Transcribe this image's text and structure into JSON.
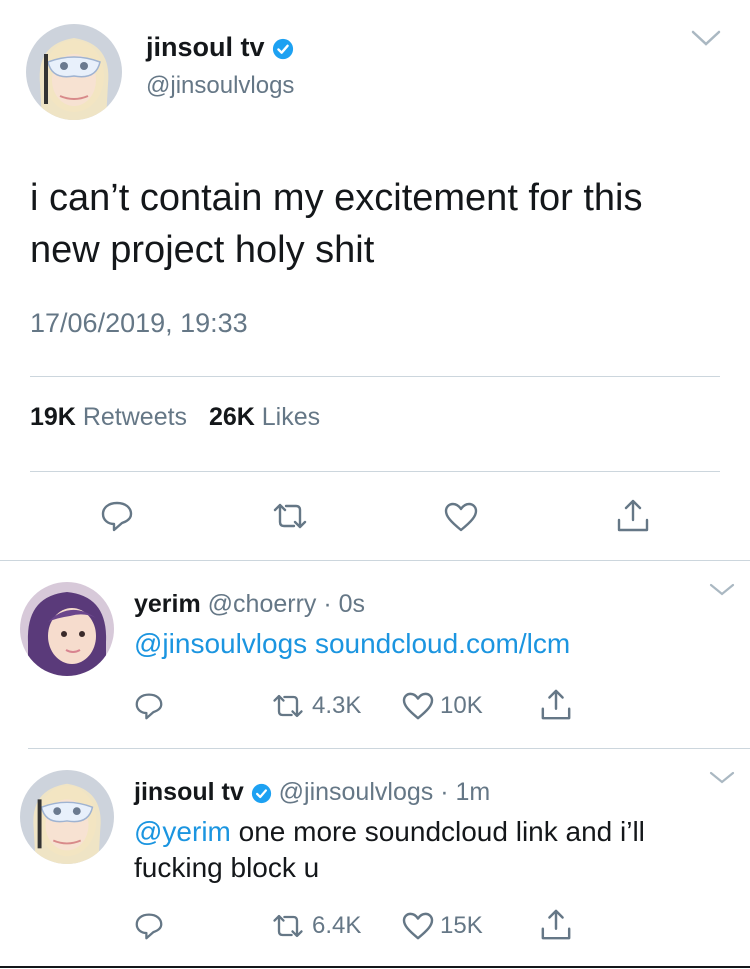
{
  "main_tweet": {
    "display_name": "jinsoul tv",
    "handle": "@jinsoulvlogs",
    "text_line1": "i can’t contain my excitement for this",
    "text_line2": "new project holy shit",
    "timestamp": "17/06/2019, 19:33",
    "retweets_count": "19K",
    "retweets_label": "Retweets",
    "likes_count": "26K",
    "likes_label": "Likes"
  },
  "replies": [
    {
      "display_name": "yerim",
      "handle": "@choerry",
      "separator": "·",
      "time": "0s",
      "mention": "@jinsoulvlogs",
      "text": "soundcloud.com/lcm",
      "retweets": "4.3K",
      "likes": "10K"
    },
    {
      "display_name": "jinsoul tv",
      "handle": "@jinsoulvlogs",
      "separator": "·",
      "time": "1m",
      "mention": "@yerim",
      "text_line1": "one more soundcloud link and i’ll",
      "text_line2": "fucking block u",
      "retweets": "6.4K",
      "likes": "15K"
    }
  ],
  "colors": {
    "accent": "#1b95e0",
    "text": "#14171a",
    "secondary": "#657786",
    "divider": "#ccd6dd"
  },
  "icons": [
    "chevron-down-icon",
    "verified-badge-icon",
    "reply-icon",
    "retweet-icon",
    "like-icon",
    "share-icon"
  ]
}
